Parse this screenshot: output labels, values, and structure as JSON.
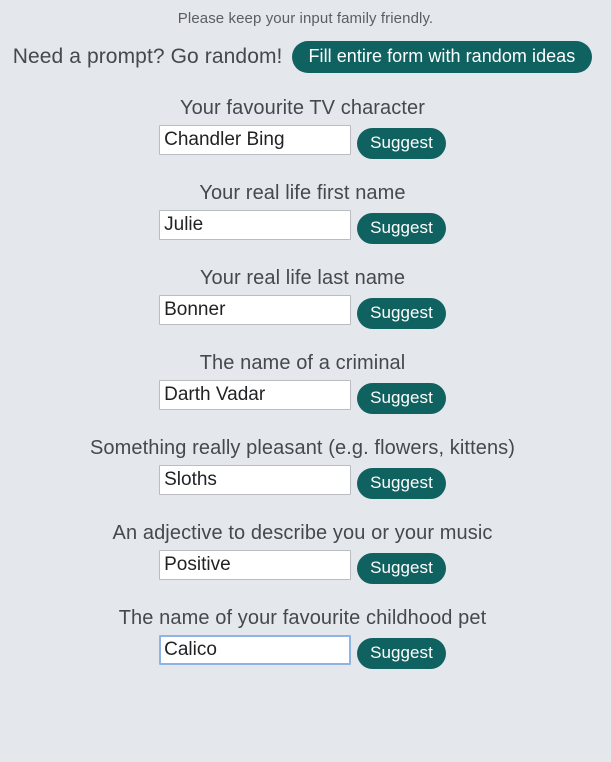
{
  "notice": "Please keep your input family friendly.",
  "random_prompt": {
    "label": "Need a prompt? Go random!",
    "button_label": "Fill entire form with random ideas"
  },
  "suggest_button_label": "Suggest",
  "colors": {
    "background": "#e4e7ec",
    "accent_teal": "#106261",
    "label_text": "#45494d",
    "input_border": "#b9bcc0",
    "input_focus_border": "#8fb3e4"
  },
  "fields": [
    {
      "label": "Your favourite TV character",
      "value": "Chandler Bing",
      "placeholder": "",
      "suggest_label": "Suggest",
      "focused": false
    },
    {
      "label": "Your real life first name",
      "value": "Julie",
      "placeholder": "",
      "suggest_label": "Suggest",
      "focused": false
    },
    {
      "label": "Your real life last name",
      "value": "Bonner",
      "placeholder": "",
      "suggest_label": "Suggest",
      "focused": false
    },
    {
      "label": "The name of a criminal",
      "value": "Darth Vadar",
      "placeholder": "",
      "suggest_label": "Suggest",
      "focused": false
    },
    {
      "label": "Something really pleasant (e.g. flowers, kittens)",
      "value": "Sloths",
      "placeholder": "",
      "suggest_label": "Suggest",
      "focused": false
    },
    {
      "label": "An adjective to describe you or your music",
      "value": "Positive",
      "placeholder": "",
      "suggest_label": "Suggest",
      "focused": false
    },
    {
      "label": "The name of your favourite childhood pet",
      "value": "Calico",
      "placeholder": "",
      "suggest_label": "Suggest",
      "focused": true
    }
  ]
}
